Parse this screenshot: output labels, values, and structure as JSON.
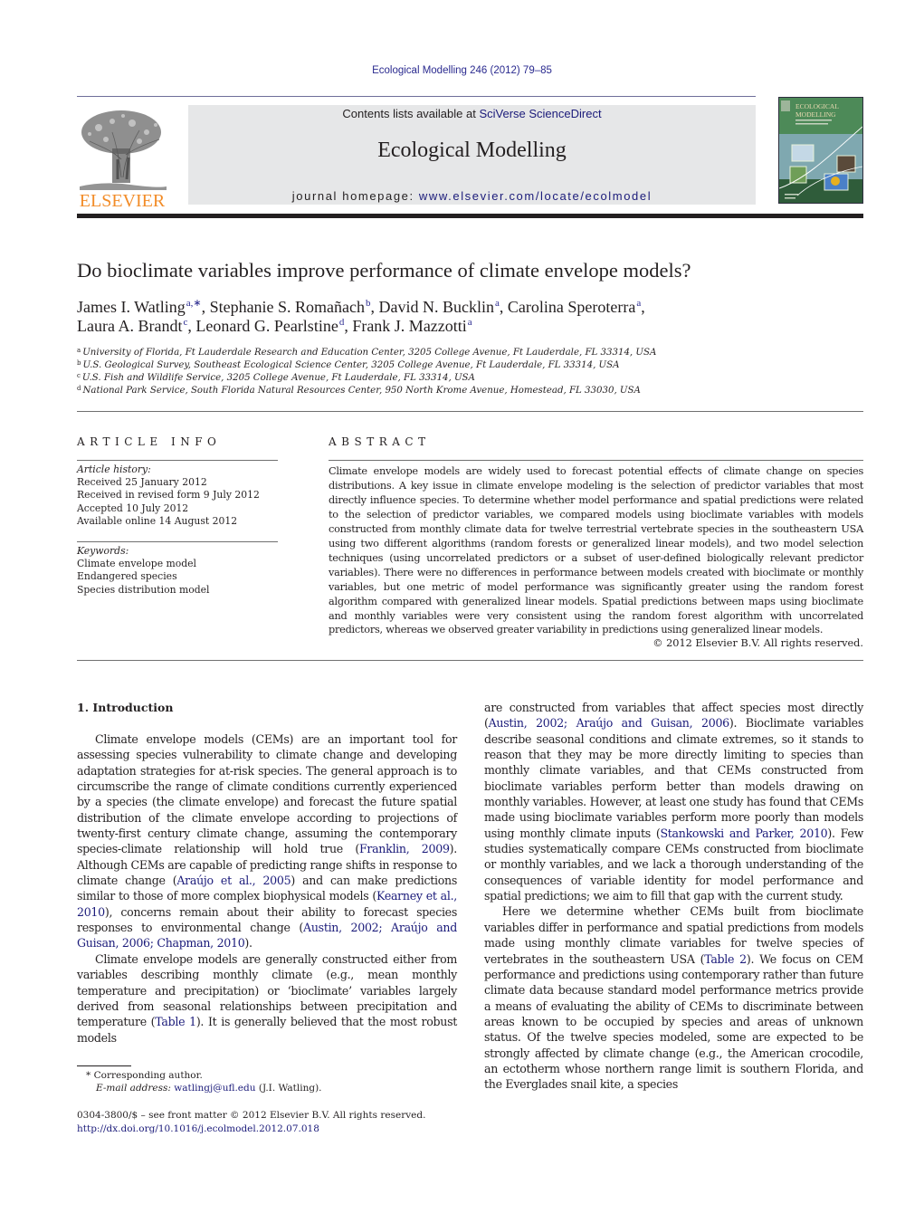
{
  "header": {
    "citation": "Ecological Modelling 246 (2012) 79–85",
    "contents_prefix": "Contents lists available at ",
    "contents_link": "SciVerse ScienceDirect",
    "journal_title": "Ecological Modelling",
    "homepage_prefix": "journal homepage: ",
    "homepage_link": "www.elsevier.com/locate/ecolmodel",
    "publisher_logo_text": "ELSEVIER",
    "cover": {
      "title_line1": "ECOLOGICAL",
      "title_line2": "MODELLING"
    },
    "colors": {
      "link": "#1b1b7a",
      "elsevier_orange": "#f28c28",
      "banner_bg": "#e6e7e8"
    }
  },
  "article": {
    "title": "Do bioclimate variables improve performance of climate envelope models?",
    "authors": [
      {
        "name": "James I. Watling",
        "aff": "a,∗",
        "sep": ", "
      },
      {
        "name": "Stephanie S. Romañach",
        "aff": "b",
        "sep": ", "
      },
      {
        "name": "David N. Bucklin",
        "aff": "a",
        "sep": ", "
      },
      {
        "name": "Carolina Speroterra",
        "aff": "a",
        "sep": ","
      },
      {
        "name": "Laura A. Brandt",
        "aff": "c",
        "sep": ", "
      },
      {
        "name": "Leonard G. Pearlstine",
        "aff": "d",
        "sep": ", "
      },
      {
        "name": "Frank J. Mazzotti",
        "aff": "a",
        "sep": ""
      }
    ],
    "affiliations": [
      {
        "key": "a",
        "text": "University of Florida, Ft Lauderdale Research and Education Center, 3205 College Avenue, Ft Lauderdale, FL 33314, USA"
      },
      {
        "key": "b",
        "text": "U.S. Geological Survey, Southeast Ecological Science Center, 3205 College Avenue, Ft Lauderdale, FL 33314, USA"
      },
      {
        "key": "c",
        "text": "U.S. Fish and Wildlife Service, 3205 College Avenue, Ft Lauderdale, FL 33314, USA"
      },
      {
        "key": "d",
        "text": "National Park Service, South Florida Natural Resources Center, 950 North Krome Avenue, Homestead, FL 33030, USA"
      }
    ]
  },
  "article_info": {
    "heading": "ARTICLE INFO",
    "history_label": "Article history:",
    "history": [
      "Received 25 January 2012",
      "Received in revised form 9 July 2012",
      "Accepted 10 July 2012",
      "Available online 14 August 2012"
    ],
    "keywords_label": "Keywords:",
    "keywords": [
      "Climate envelope model",
      "Endangered species",
      "Species distribution model"
    ]
  },
  "abstract": {
    "heading": "ABSTRACT",
    "text": "Climate envelope models are widely used to forecast potential effects of climate change on species distributions. A key issue in climate envelope modeling is the selection of predictor variables that most directly influence species. To determine whether model performance and spatial predictions were related to the selection of predictor variables, we compared models using bioclimate variables with models constructed from monthly climate data for twelve terrestrial vertebrate species in the southeastern USA using two different algorithms (random forests or generalized linear models), and two model selection techniques (using uncorrelated predictors or a subset of user-defined biologically relevant predictor variables). There were no differences in performance between models created with bioclimate or monthly variables, but one metric of model performance was significantly greater using the random forest algorithm compared with generalized linear models. Spatial predictions between maps using bioclimate and monthly variables were very consistent using the random forest algorithm with uncorrelated predictors, whereas we observed greater variability in predictions using generalized linear models.",
    "copyright": "© 2012 Elsevier B.V. All rights reserved."
  },
  "body": {
    "section_heading": "1.  Introduction",
    "left_paragraphs": [
      [
        {
          "t": "Climate envelope models (CEMs) are an important tool for assessing species vulnerability to climate change and developing adaptation strategies for at-risk species. The general approach is to circumscribe the range of climate conditions currently experienced by a species (the climate envelope) and forecast the future spatial distribution of the climate envelope according to projections of twenty-first century climate change, assuming the contemporary species-climate relationship will hold true ("
        },
        {
          "t": "Franklin, 2009",
          "link": true
        },
        {
          "t": "). Although CEMs are capable of predicting range shifts in response to climate change ("
        },
        {
          "t": "Araújo et al., 2005",
          "link": true
        },
        {
          "t": ") and can make predictions similar to those of more complex biophysical models ("
        },
        {
          "t": "Kearney et al., 2010",
          "link": true
        },
        {
          "t": "), concerns remain about their ability to forecast species responses to environmental change ("
        },
        {
          "t": "Austin, 2002; Araújo and Guisan, 2006; Chapman, 2010",
          "link": true
        },
        {
          "t": ")."
        }
      ],
      [
        {
          "t": "Climate envelope models are generally constructed either from variables describing monthly climate (e.g., mean monthly temperature and precipitation) or ‘bioclimate’ variables largely derived from seasonal relationships between precipitation and temperature ("
        },
        {
          "t": "Table 1",
          "link": true
        },
        {
          "t": "). It is generally believed that the most robust models"
        }
      ]
    ],
    "right_paragraphs": [
      [
        {
          "t": "are constructed from variables that affect species most directly ("
        },
        {
          "t": "Austin, 2002; Araújo and Guisan, 2006",
          "link": true
        },
        {
          "t": "). Bioclimate variables describe seasonal conditions and climate extremes, so it stands to reason that they may be more directly limiting to species than monthly climate variables, and that CEMs constructed from bioclimate variables perform better than models drawing on monthly variables. However, at least one study has found that CEMs made using bioclimate variables perform more poorly than models using monthly climate inputs ("
        },
        {
          "t": "Stankowski and Parker, 2010",
          "link": true
        },
        {
          "t": "). Few studies systematically compare CEMs constructed from bioclimate or monthly variables, and we lack a thorough understanding of the consequences of variable identity for model performance and spatial predictions; we aim to fill that gap with the current study."
        }
      ],
      [
        {
          "t": "Here we determine whether CEMs built from bioclimate variables differ in performance and spatial predictions from models made using monthly climate variables for twelve species of vertebrates in the southeastern USA ("
        },
        {
          "t": "Table 2",
          "link": true
        },
        {
          "t": "). We focus on CEM performance and predictions using contemporary rather than future climate data because standard model performance metrics provide a means of evaluating the ability of CEMs to discriminate between areas known to be occupied by species and areas of unknown status. Of the twelve species modeled, some are expected to be strongly affected by climate change (e.g., the American crocodile, an ectotherm whose northern range limit is southern Florida, and the Everglades snail kite, a species"
        }
      ]
    ]
  },
  "footnotes": {
    "corresponding_mark": "*",
    "corresponding_text": "Corresponding author.",
    "email_label": "E-mail address:",
    "email": "watlingj@ufl.edu",
    "email_suffix": " (J.I. Watling).",
    "issn_line": "0304-3800/$ – see front matter © 2012 Elsevier B.V. All rights reserved.",
    "doi": "http://dx.doi.org/10.1016/j.ecolmodel.2012.07.018"
  }
}
